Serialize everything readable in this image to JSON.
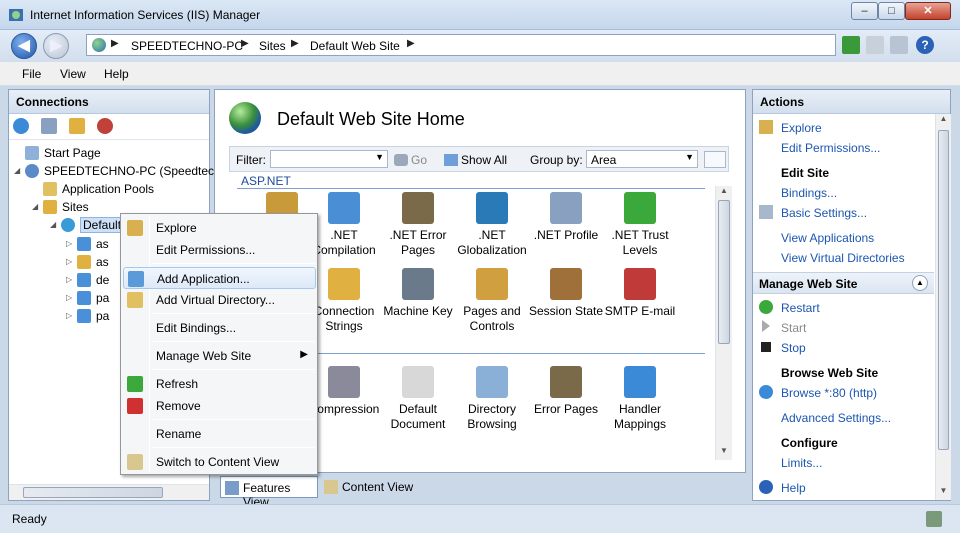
{
  "window": {
    "title": "Internet Information Services (IIS) Manager"
  },
  "titlebar": {
    "min": "–",
    "max": "□",
    "close": "✕"
  },
  "navigation": {
    "back": "◀",
    "forward": "▶",
    "breadcrumbs": [
      "SPEEDTECHNO-PC",
      "Sites",
      "Default Web Site"
    ],
    "separator": "▶",
    "help_label": "?"
  },
  "menu": [
    "File",
    "View",
    "Help"
  ],
  "connections": {
    "header": "Connections",
    "tree": [
      {
        "label": "Start Page",
        "level": 0,
        "expander": ""
      },
      {
        "label": "SPEEDTECHNO-PC (Speedtec",
        "level": 0,
        "expander": "◢"
      },
      {
        "label": "Application Pools",
        "level": 1,
        "expander": ""
      },
      {
        "label": "Sites",
        "level": 1,
        "expander": "◢"
      },
      {
        "label": "Default Web Site",
        "level": 2,
        "expander": "◢"
      },
      {
        "label": "as",
        "level": 3,
        "expander": "▷"
      },
      {
        "label": "as",
        "level": 3,
        "expander": "▷"
      },
      {
        "label": "de",
        "level": 3,
        "expander": "▷"
      },
      {
        "label": "pa",
        "level": 3,
        "expander": "▷"
      },
      {
        "label": "pa",
        "level": 3,
        "expander": "▷"
      }
    ]
  },
  "context_menu": {
    "items": [
      {
        "label": "Explore",
        "icon": "explore-icon",
        "highlighted": false,
        "submenu": false
      },
      {
        "label": "Edit Permissions...",
        "icon": "",
        "highlighted": false,
        "submenu": false
      },
      {
        "label": "Add Application...",
        "icon": "add-application-icon",
        "highlighted": true,
        "submenu": false
      },
      {
        "label": "Add Virtual Directory...",
        "icon": "add-virtual-directory-icon",
        "highlighted": false,
        "submenu": false
      },
      {
        "label": "Edit Bindings...",
        "icon": "",
        "highlighted": false,
        "submenu": false
      },
      {
        "label": "Manage Web Site",
        "icon": "",
        "highlighted": false,
        "submenu": true
      },
      {
        "label": "Refresh",
        "icon": "refresh-icon",
        "highlighted": false,
        "submenu": false
      },
      {
        "label": "Remove",
        "icon": "remove-icon",
        "highlighted": false,
        "submenu": false
      },
      {
        "label": "Rename",
        "icon": "",
        "highlighted": false,
        "submenu": false
      },
      {
        "label": "Switch to Content View",
        "icon": "content-view-icon",
        "highlighted": false,
        "submenu": false
      }
    ],
    "submenu_arrow": "▶"
  },
  "main": {
    "title": "Default Web Site Home",
    "filter": {
      "label": "Filter:",
      "go": "Go",
      "show_all": "Show All",
      "group_by_label": "Group by:",
      "group_by_value": "Area"
    },
    "group_aspnet": "ASP.NET",
    "features_row1": [
      {
        "label": "",
        "label2": "",
        "icon": "authorization-icon",
        "color": "#c89a3a"
      },
      {
        "label": ".NET",
        "label2": "Compilation",
        "icon": "compilation-icon",
        "color": "#4a8fd6"
      },
      {
        "label": ".NET Error",
        "label2": "Pages",
        "icon": "error-pages-icon",
        "color": "#7a6a4a"
      },
      {
        "label": ".NET",
        "label2": "Globalization",
        "icon": "globalization-icon",
        "color": "#2a7ab8"
      },
      {
        "label": ".NET Profile",
        "label2": "",
        "icon": "profile-icon",
        "color": "#8aa0c0"
      },
      {
        "label": ".NET Trust",
        "label2": "Levels",
        "icon": "trust-levels-icon",
        "color": "#3aa83a"
      }
    ],
    "features_row2": [
      {
        "label": "",
        "label2": "",
        "icon": "application-settings-icon",
        "color": "#b0b8c8"
      },
      {
        "label": "Connection",
        "label2": "Strings",
        "icon": "connection-strings-icon",
        "color": "#e0b040"
      },
      {
        "label": "Machine Key",
        "label2": "",
        "icon": "machine-key-icon",
        "color": "#6a7a8a"
      },
      {
        "label": "Pages and",
        "label2": "Controls",
        "icon": "pages-controls-icon",
        "color": "#d0a040"
      },
      {
        "label": "Session State",
        "label2": "",
        "icon": "session-state-icon",
        "color": "#a0703a"
      },
      {
        "label": "SMTP E-mail",
        "label2": "",
        "icon": "smtp-email-icon",
        "color": "#c03a3a"
      }
    ],
    "features_row3": [
      {
        "label": "",
        "label2": "",
        "icon": "authentication-icon",
        "color": "#5a6a8a"
      },
      {
        "label": "Compression",
        "label2": "",
        "icon": "compression-icon",
        "color": "#8a8a9a"
      },
      {
        "label": "Default",
        "label2": "Document",
        "icon": "default-document-icon",
        "color": "#d8d8d8"
      },
      {
        "label": "Directory",
        "label2": "Browsing",
        "icon": "directory-browsing-icon",
        "color": "#8ab0d8"
      },
      {
        "label": "Error Pages",
        "label2": "",
        "icon": "error-pages-icon",
        "color": "#7a6a4a"
      },
      {
        "label": "Handler",
        "label2": "Mappings",
        "icon": "handler-mappings-icon",
        "color": "#3a8ad8"
      }
    ],
    "view_tabs": {
      "features": "Features View",
      "content": "Content View"
    }
  },
  "actions": {
    "header": "Actions",
    "items_top": [
      {
        "label": "Explore",
        "icon": "explore-icon"
      },
      {
        "label": "Edit Permissions...",
        "icon": ""
      }
    ],
    "edit_site_head": "Edit Site",
    "edit_site": [
      {
        "label": "Bindings...",
        "icon": ""
      },
      {
        "label": "Basic Settings...",
        "icon": "basic-settings-icon"
      },
      {
        "label": "View Applications",
        "icon": ""
      },
      {
        "label": "View Virtual Directories",
        "icon": ""
      }
    ],
    "manage_head": "Manage Web Site",
    "manage": [
      {
        "label": "Restart",
        "icon": "restart-icon"
      },
      {
        "label": "Start",
        "icon": "start-icon"
      },
      {
        "label": "Stop",
        "icon": "stop-icon"
      }
    ],
    "browse_head": "Browse Web Site",
    "browse": [
      {
        "label": "Browse *:80 (http)",
        "icon": "browse-icon"
      }
    ],
    "advanced": "Advanced Settings...",
    "configure_head": "Configure",
    "limits": "Limits...",
    "help": "Help"
  },
  "status": {
    "text": "Ready"
  }
}
